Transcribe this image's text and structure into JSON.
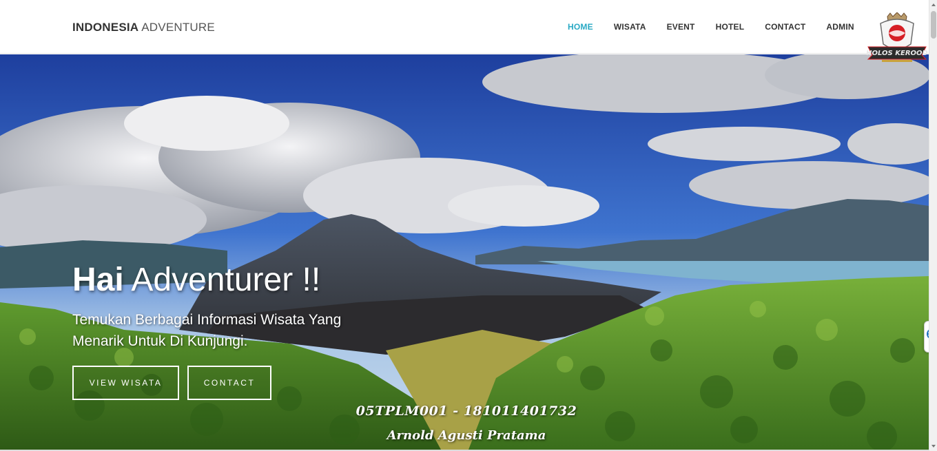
{
  "navbar": {
    "brand_bold": "INDONESIA",
    "brand_light": "ADVENTURE",
    "items": [
      {
        "label": "HOME",
        "active": true
      },
      {
        "label": "WISATA",
        "active": false
      },
      {
        "label": "EVENT",
        "active": false
      },
      {
        "label": "HOTEL",
        "active": false
      },
      {
        "label": "CONTACT",
        "active": false
      },
      {
        "label": "ADMIN",
        "active": false
      }
    ],
    "active_color": "#29a9c4"
  },
  "logo": {
    "text": "HOLOS KEROOD",
    "icon": "crest-logo-icon"
  },
  "hero": {
    "title_bold": "Hai",
    "title_thin": "Adventurer !!",
    "subtitle_line1": "Temukan Berbagai Informasi Wisata Yang",
    "subtitle_line2": "Menarik Untuk Di Kunjungi.",
    "button_wisata": "VIEW WISATA",
    "button_contact": "CONTACT",
    "signature_line1": "05TPLM001 - 181011401732",
    "signature_line2": "Arnold Agusti Pratama"
  },
  "colors": {
    "sky_top": "#2a4fb0",
    "cloud": "#e8e8ea",
    "mountain": "#4a5a6a",
    "forest": "#4f8a2a",
    "lake": "#7fb6d4"
  }
}
